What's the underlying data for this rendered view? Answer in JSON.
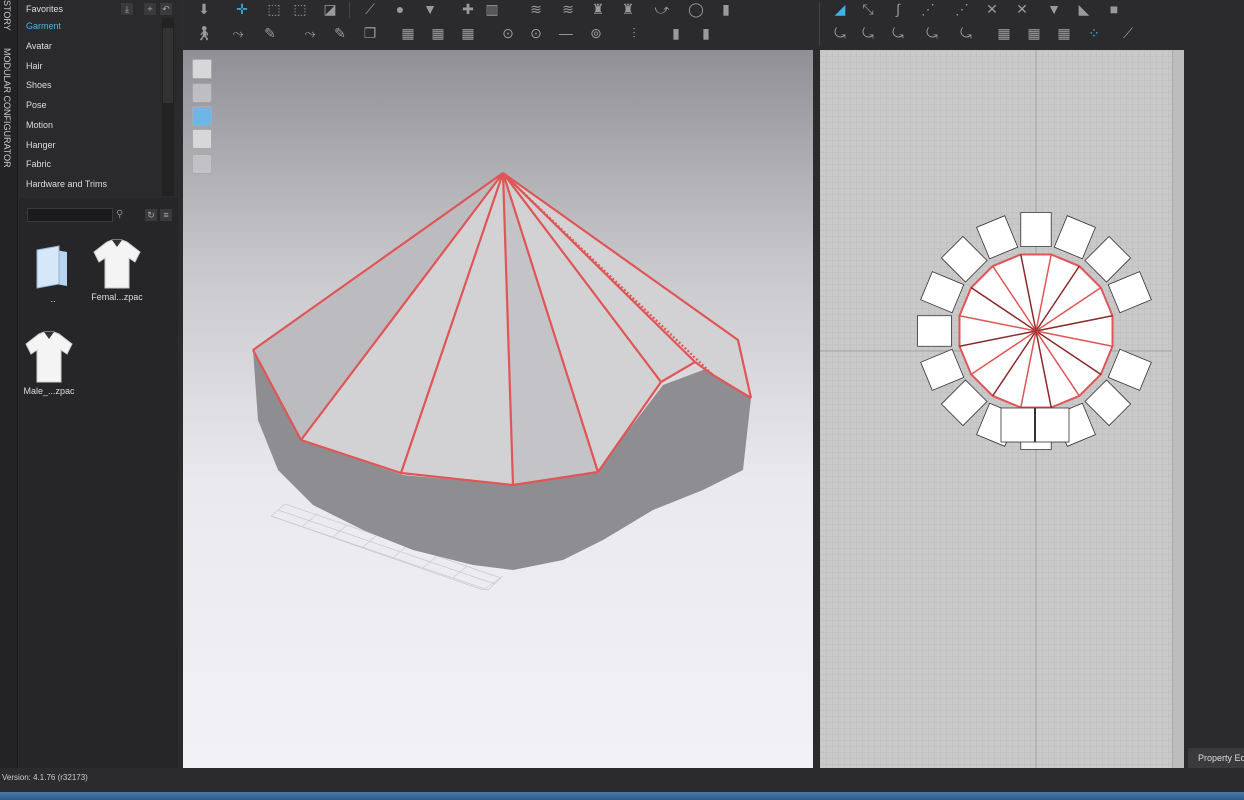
{
  "side_tabs": [
    "STORY",
    "MODULAR CONFIGURATOR"
  ],
  "library": {
    "header": "Favorites",
    "categories": [
      "Garment",
      "Avatar",
      "Hair",
      "Shoes",
      "Pose",
      "Motion",
      "Hanger",
      "Fabric",
      "Hardware and Trims"
    ],
    "selected": "Garment",
    "search_placeholder": "",
    "files": [
      {
        "label": "..",
        "icon": "folder-icon"
      },
      {
        "label": "Femal...zpac",
        "icon": "tshirt-icon"
      },
      {
        "label": "Male_...zpac",
        "icon": "tshirt-icon"
      }
    ]
  },
  "right_panel": {
    "tab": "Property Editor"
  },
  "status": {
    "version": "Version: 4.1.76 (r32173)"
  },
  "colors": {
    "accent": "#4fb3e6",
    "seam": "#e05555"
  }
}
